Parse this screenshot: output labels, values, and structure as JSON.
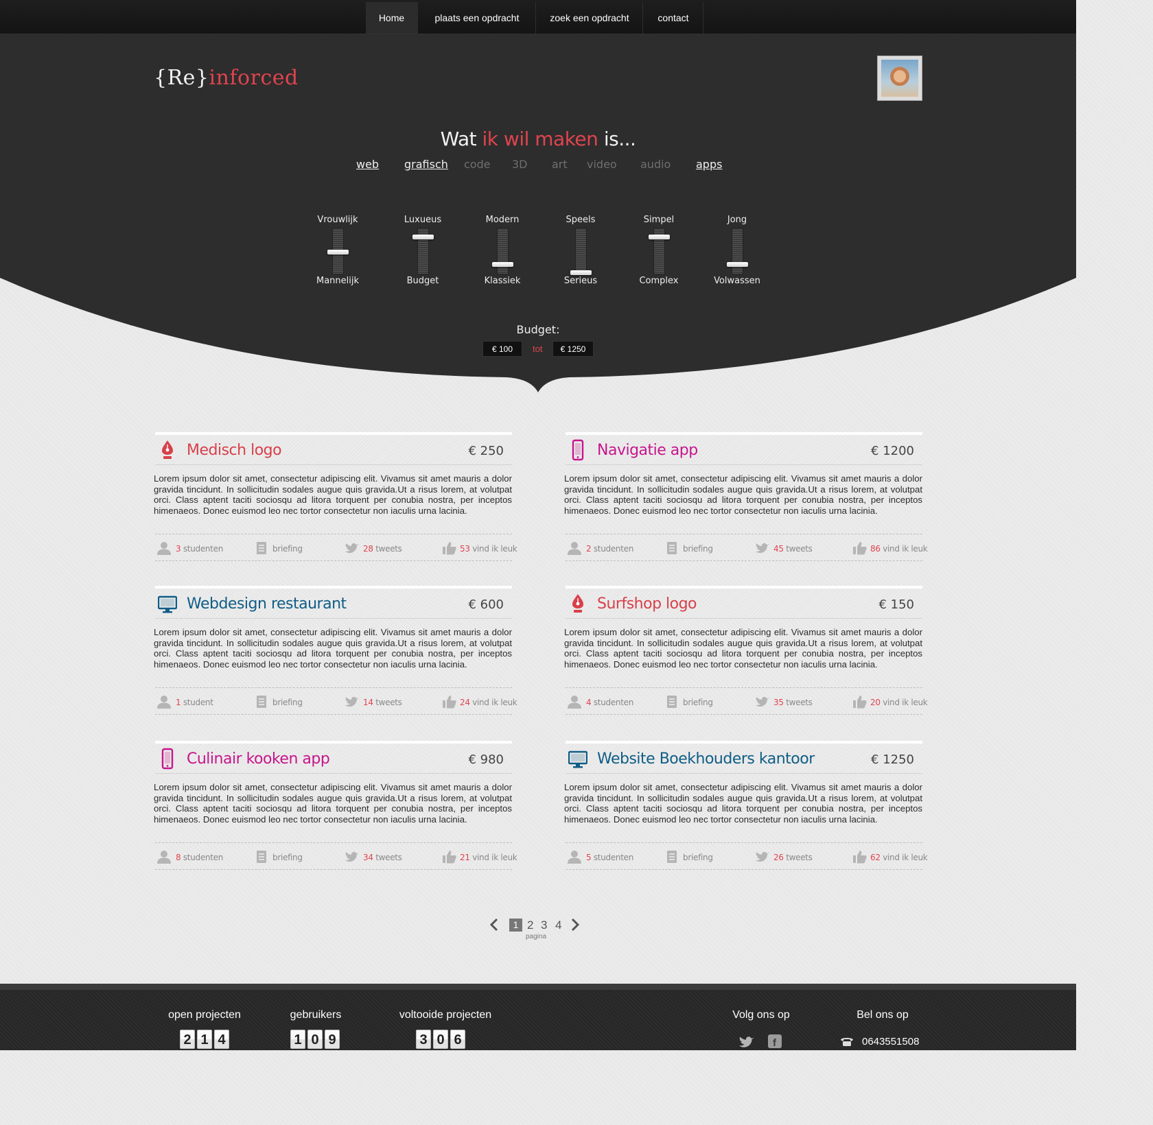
{
  "nav": {
    "items": [
      {
        "label": "Home",
        "active": true
      },
      {
        "label": "plaats een opdracht"
      },
      {
        "label": "zoek een opdracht"
      },
      {
        "label": "contact"
      }
    ]
  },
  "brand": {
    "part1": "{Re}",
    "part2": "inforced"
  },
  "headline": {
    "pre": "Wat ",
    "highlight": "ik wil maken",
    "post": " is..."
  },
  "categories": [
    {
      "label": "web",
      "selected": true
    },
    {
      "label": "grafisch",
      "selected": true
    },
    {
      "label": "code",
      "selected": false
    },
    {
      "label": "3D",
      "selected": false
    },
    {
      "label": "art",
      "selected": false
    },
    {
      "label": "video",
      "selected": false
    },
    {
      "label": "audio",
      "selected": false
    },
    {
      "label": "apps",
      "selected": true
    }
  ],
  "sliders": [
    {
      "top": "Vrouwlijk",
      "bottom": "Mannelijk",
      "level": 0.5
    },
    {
      "top": "Luxueus",
      "bottom": "Budget",
      "level": 0.85
    },
    {
      "top": "Modern",
      "bottom": "Klassiek",
      "level": 0.2
    },
    {
      "top": "Speels",
      "bottom": "Serieus",
      "level": 0.0
    },
    {
      "top": "Simpel",
      "bottom": "Complex",
      "level": 0.85
    },
    {
      "top": "Jong",
      "bottom": "Volwassen",
      "level": 0.2
    }
  ],
  "budget": {
    "label": "Budget:",
    "min": "€ 100",
    "connector": "tot",
    "max": "€ 1250"
  },
  "lorem": "Lorem ipsum dolor sit amet, consectetur adipiscing elit. Vivamus sit amet mauris a dolor gravida tincidunt. In sollicitudin sodales augue quis gravida.Ut a risus lorem, at volutpat orci. Class aptent taciti sociosqu ad litora torquent per conubia nostra, per inceptos himenaeos. Donec euismod leo nec tortor consectetur non iaculis urna lacinia.",
  "labels": {
    "briefing": "briefing",
    "tweets": "tweets",
    "likes": "vind ik leuk"
  },
  "colors": {
    "red": "#d8404a",
    "magenta": "#c7158c",
    "blue": "#0f5d86"
  },
  "projects": [
    {
      "title": "Medisch logo",
      "price": "€ 250",
      "icon": "pen-nib-icon",
      "color": "#d8404a",
      "students": "3",
      "students_label": "studenten",
      "tweets": "28",
      "likes": "53"
    },
    {
      "title": "Navigatie app",
      "price": "€ 1200",
      "icon": "phone-icon",
      "color": "#c7158c",
      "students": "2",
      "students_label": "studenten",
      "tweets": "45",
      "likes": "86"
    },
    {
      "title": "Webdesign restaurant",
      "price": "€ 600",
      "icon": "monitor-icon",
      "color": "#0f5d86",
      "students": "1",
      "students_label": "student",
      "tweets": "14",
      "likes": "24"
    },
    {
      "title": "Surfshop logo",
      "price": "€ 150",
      "icon": "pen-nib-icon",
      "color": "#d8404a",
      "students": "4",
      "students_label": "studenten",
      "tweets": "35",
      "likes": "20"
    },
    {
      "title": "Culinair kooken app",
      "price": "€ 980",
      "icon": "phone-icon",
      "color": "#c7158c",
      "students": "8",
      "students_label": "studenten",
      "tweets": "34",
      "likes": "21"
    },
    {
      "title": "Website Boekhouders kantoor",
      "price": "€ 1250",
      "icon": "monitor-icon",
      "color": "#0f5d86",
      "students": "5",
      "students_label": "studenten",
      "tweets": "26",
      "likes": "62"
    }
  ],
  "pagination": {
    "pages": [
      "1",
      "2",
      "3",
      "4"
    ],
    "current": "1",
    "label": "pagina"
  },
  "footer": {
    "open": {
      "label": "open projecten",
      "digits": [
        "2",
        "1",
        "4"
      ]
    },
    "users": {
      "label": "gebruikers",
      "digits": [
        "1",
        "0",
        "9"
      ]
    },
    "done": {
      "label": "voltooide projecten",
      "digits": [
        "3",
        "0",
        "6"
      ]
    },
    "follow": "Volg ons op",
    "call": "Bel ons op",
    "phone": "0643551508"
  }
}
